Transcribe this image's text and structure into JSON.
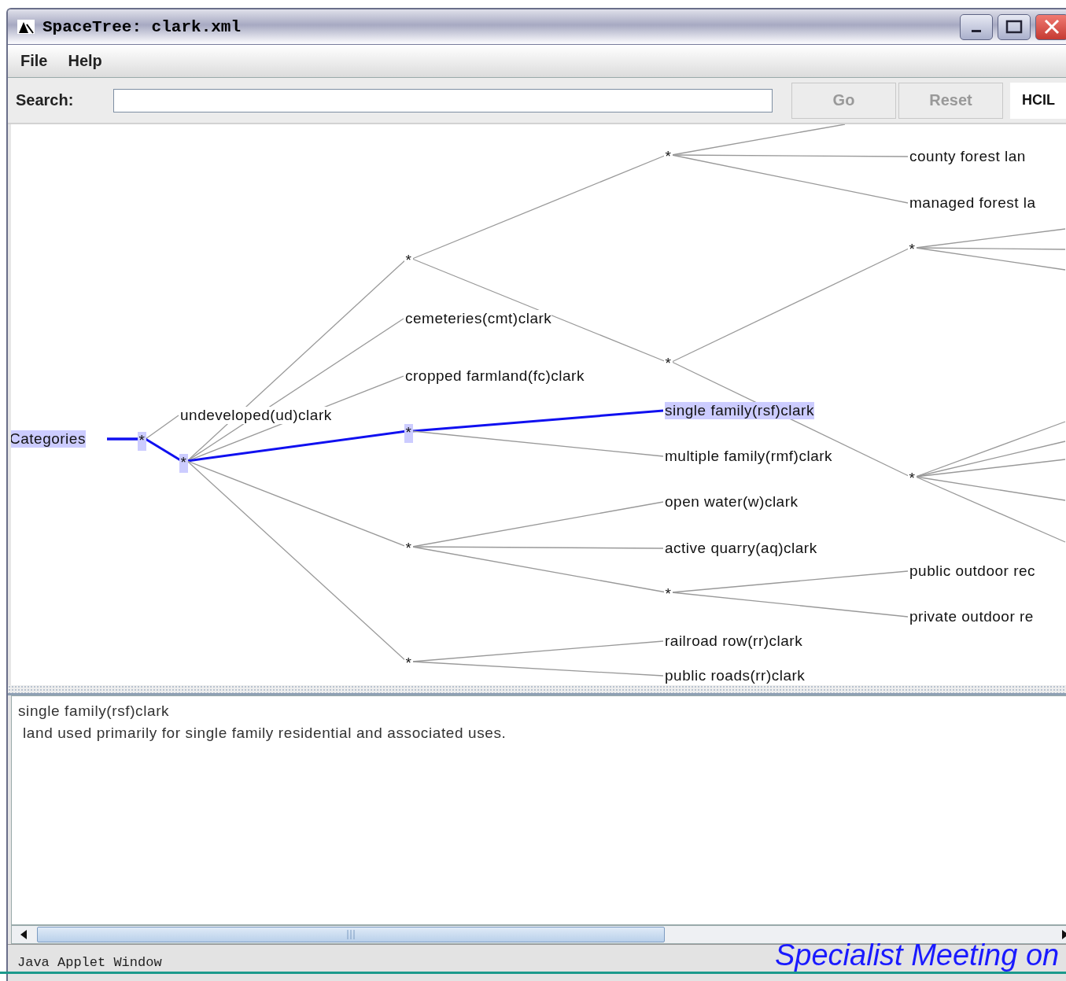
{
  "window": {
    "title": "SpaceTree:  clark.xml"
  },
  "menu": [
    {
      "label": "File"
    },
    {
      "label": "Help"
    }
  ],
  "toolbar": {
    "search_label": "Search:",
    "buttons": [
      {
        "label": "Go",
        "disabled": true
      },
      {
        "label": "Reset",
        "disabled": true
      }
    ],
    "logo": "HCIL"
  },
  "tree": {
    "label": "Categories",
    "selected": true,
    "children": [
      {
        "label": "*",
        "selected": true,
        "children": [
          {
            "label": "undeveloped(ud)clark",
            "selected": false
          },
          {
            "label": "*",
            "selected": true,
            "children": [
              {
                "label": "*",
                "selected": false,
                "children": [
                  {
                    "label": "*",
                    "selected": false,
                    "children": [
                      {
                        "kind": "offscreen"
                      },
                      {
                        "label": "county forest lan",
                        "selected": false
                      },
                      {
                        "label": "managed forest la",
                        "selected": false
                      }
                    ]
                  },
                  {
                    "label": "*",
                    "selected": false,
                    "children": [
                      {
                        "label": "*",
                        "selected": false,
                        "children": [
                          {
                            "kind": "offscreen"
                          },
                          {
                            "kind": "offscreen"
                          },
                          {
                            "kind": "offscreen"
                          }
                        ]
                      },
                      {
                        "label": "*",
                        "selected": false,
                        "children": [
                          {
                            "kind": "offscreen"
                          },
                          {
                            "kind": "offscreen"
                          },
                          {
                            "kind": "offscreen"
                          },
                          {
                            "kind": "offscreen"
                          },
                          {
                            "kind": "offscreen"
                          }
                        ]
                      }
                    ]
                  }
                ]
              },
              {
                "label": "cemeteries(cmt)clark",
                "selected": false
              },
              {
                "label": "cropped farmland(fc)clark",
                "selected": false
              },
              {
                "label": "*",
                "selected": true,
                "children": [
                  {
                    "label": "single family(rsf)clark",
                    "selected": true
                  },
                  {
                    "label": "multiple family(rmf)clark",
                    "selected": false
                  }
                ]
              },
              {
                "label": "*",
                "selected": false,
                "children": [
                  {
                    "label": "open water(w)clark",
                    "selected": false
                  },
                  {
                    "label": "active quarry(aq)clark",
                    "selected": false
                  },
                  {
                    "label": "*",
                    "selected": false,
                    "children": [
                      {
                        "label": "public outdoor rec",
                        "selected": false
                      },
                      {
                        "label": "private outdoor re",
                        "selected": false
                      }
                    ]
                  }
                ]
              },
              {
                "label": "*",
                "selected": false,
                "children": [
                  {
                    "label": "railroad row(rr)clark",
                    "selected": false
                  },
                  {
                    "label": "public roads(rr)clark",
                    "selected": false
                  }
                ]
              }
            ]
          }
        ]
      }
    ]
  },
  "details": {
    "title": "single family(rsf)clark",
    "description": "land used primarily for single family residential and associated uses."
  },
  "status_bar": "Java Applet Window",
  "slide_caption": "Specialist Meeting on"
}
